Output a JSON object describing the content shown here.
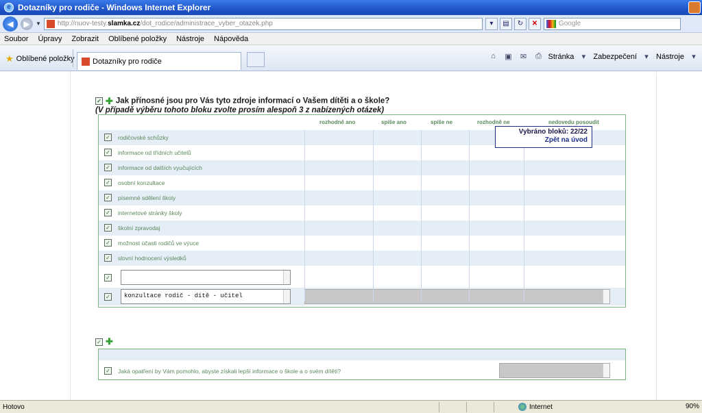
{
  "window": {
    "title": "Dotazníky pro rodiče - Windows Internet Explorer"
  },
  "address": {
    "url_prefix": "http://nuov-testy.",
    "url_domain": "slamka.cz",
    "url_path": "/dot_rodice/administrace_vyber_otazek.php",
    "search_placeholder": "Google"
  },
  "menu": {
    "items": [
      "Soubor",
      "Úpravy",
      "Zobrazit",
      "Oblíbené položky",
      "Nástroje",
      "Nápověda"
    ]
  },
  "tabs": {
    "favorites_label": "Oblíbené položky",
    "active_tab": "Dotazníky pro rodiče"
  },
  "commandbar": {
    "page": "Stránka",
    "security": "Zabezpečení",
    "tools": "Nástroje"
  },
  "question1": {
    "title": "Jak přínosné jsou pro Vás tyto zdroje informací o Vašem dítěti a o škole?",
    "subtitle": "(V případě výběru tohoto bloku zvolte prosím alespoň 3 z nabízených otázek)",
    "columns": [
      "rozhodně ano",
      "spíše ano",
      "spíše ne",
      "rozhodně ne",
      "nedovedu posoudit"
    ],
    "rows": [
      "rodičovské schůzky",
      "informace od třídních učitelů",
      "informace od dalších vyučujících",
      "osobní konzultace",
      "písemné sdělení školy",
      "internetové stránky školy",
      "školní zpravodaj",
      "možnost účasti rodičů ve výuce",
      "slovní hodnocení výsledků"
    ],
    "custom_input_1": "",
    "custom_input_2": "konzultace rodič - dítě - učitel"
  },
  "selection": {
    "count_label": "Vybráno bloků: 22/22",
    "back_link": "Zpět na úvod"
  },
  "question2": {
    "row_label": "Jaká opatření by Vám pomohlo, abyste získali lepší informace o škole a o svém dítěti?"
  },
  "status": {
    "left": "Hotovo",
    "zone": "Internet",
    "zoom": "90%"
  }
}
